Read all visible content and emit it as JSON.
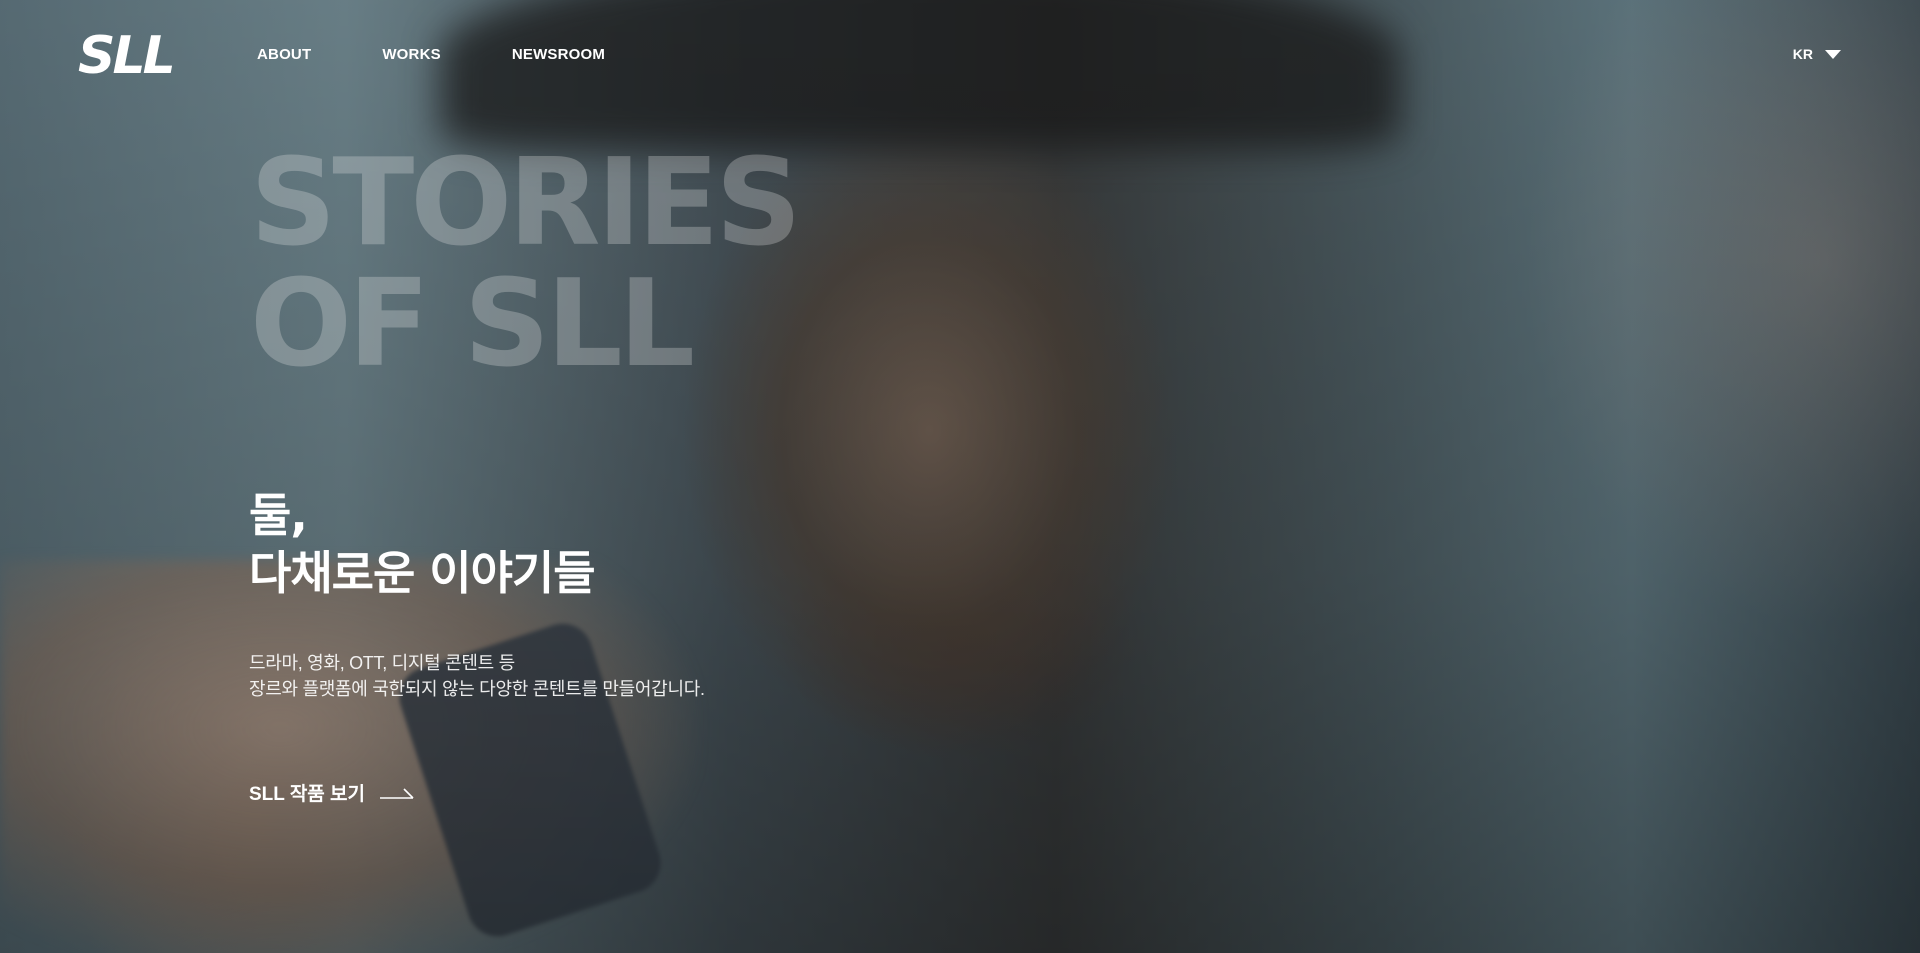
{
  "brand": {
    "logo_text": "SLL"
  },
  "nav": {
    "items": [
      {
        "label": "ABOUT"
      },
      {
        "label": "WORKS"
      },
      {
        "label": "NEWSROOM"
      }
    ]
  },
  "language": {
    "selected": "KR",
    "icon": "chevron-down-icon"
  },
  "hero": {
    "title_lines": [
      "STORIES",
      "OF SLL"
    ],
    "headline_lines": [
      "둘,",
      "다채로운 이야기들"
    ],
    "description_lines": [
      "드라마, 영화, OTT, 디지털 콘텐트 등",
      "장르와 플랫폼에 국한되지 않는 다양한 콘텐트를 만들어갑니다."
    ],
    "cta_label": "SLL 작품 보기",
    "cta_icon": "arrow-right-icon"
  },
  "colors": {
    "text": "#ffffff",
    "title_overlay": "rgba(235,235,235,0.28)"
  }
}
